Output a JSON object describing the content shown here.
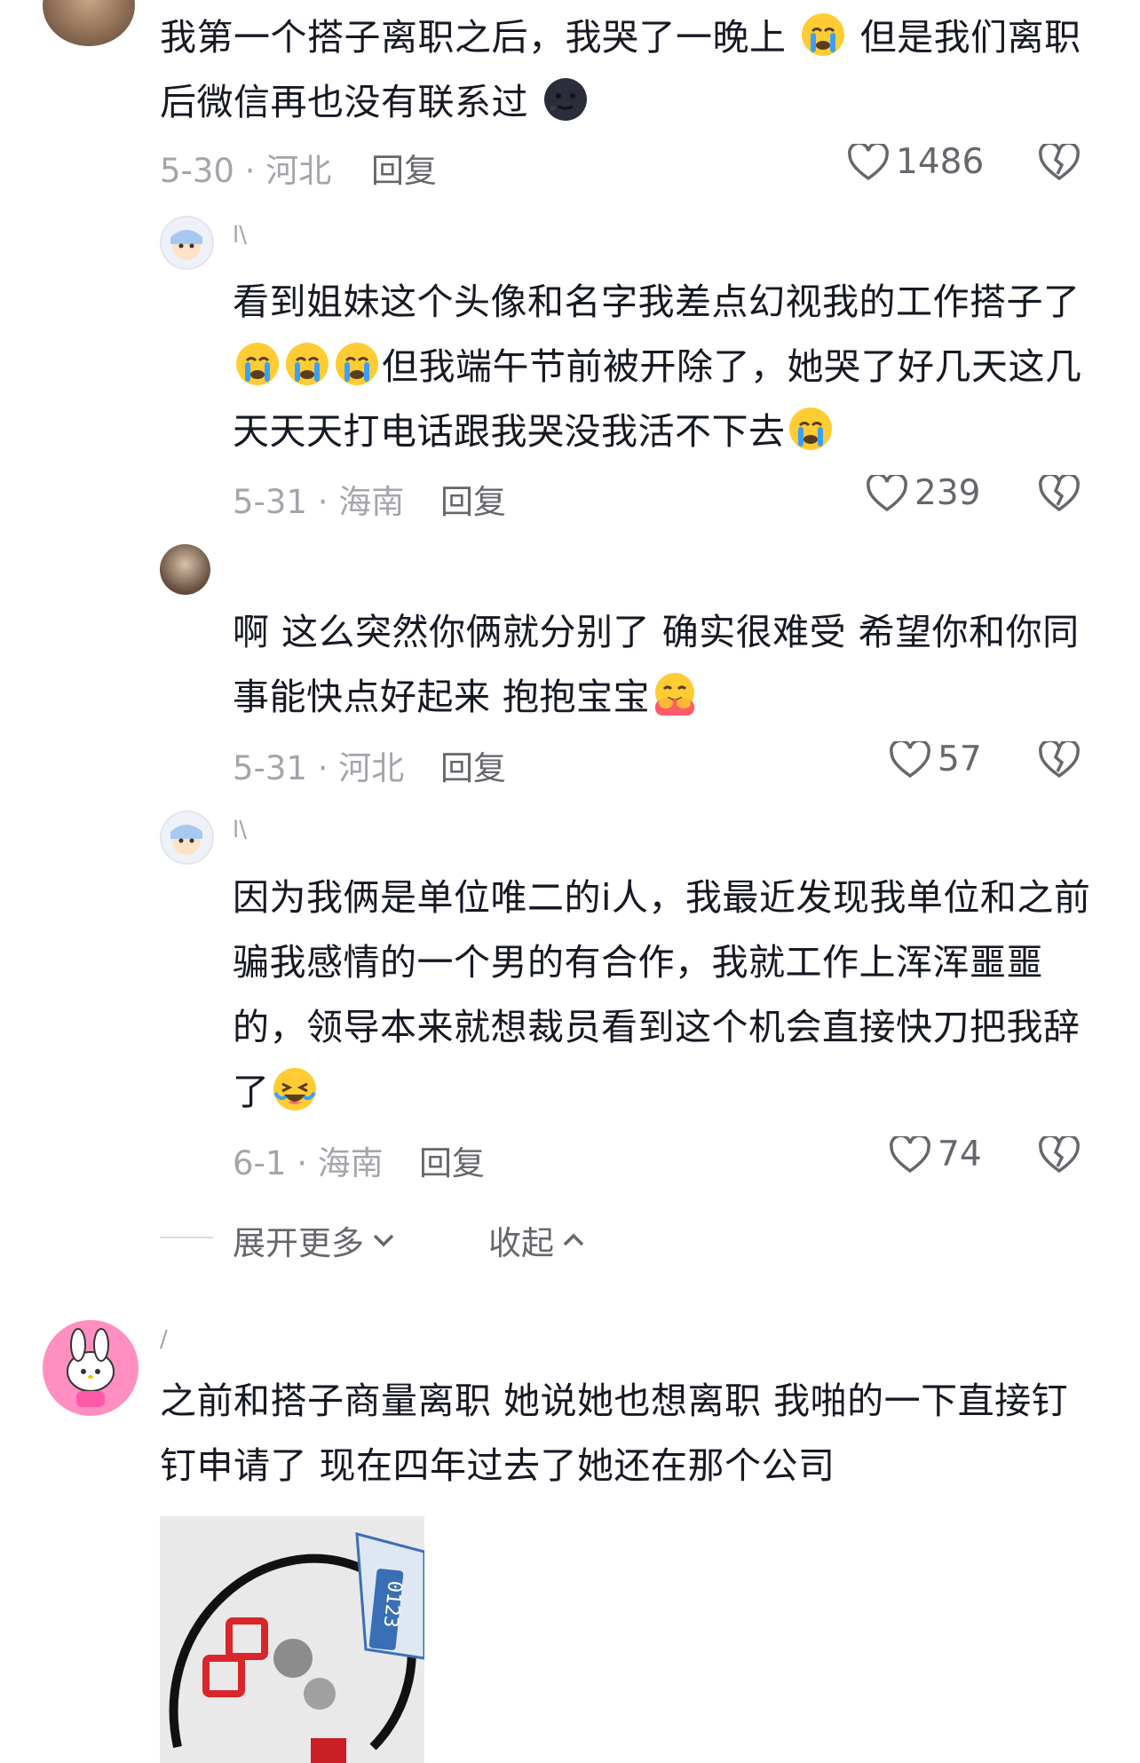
{
  "comments": [
    {
      "text_a": "我第一个搭子离职之后，我哭了一晚上",
      "text_b": "但是我们离职后微信再也没有联系过",
      "date_loc": "5-30 · 河北",
      "reply": "回复",
      "likes": "1486"
    }
  ],
  "replies": [
    {
      "username": "l\\",
      "text_a": "看到姐妹这个头像和名字我差点幻视我的工作搭子了",
      "text_b": "但我端午节前被开除了，她哭了好几天这几天天天打电话跟我哭没我活不下去",
      "date_loc": "5-31 · 海南",
      "reply": "回复",
      "likes": "239"
    },
    {
      "username": "",
      "text_a": "啊 这么突然你俩就分别了 确实很难受 希望你和你同事能快点好起来 抱抱宝宝",
      "date_loc": "5-31 · 河北",
      "reply": "回复",
      "likes": "57"
    },
    {
      "username": "l\\",
      "text_a": "因为我俩是单位唯二的i人，我最近发现我单位和之前骗我感情的一个男的有合作，我就工作上浑浑噩噩的，领导本来就想裁员看到这个机会直接快刀把我辞了",
      "date_loc": "6-1 · 海南",
      "reply": "回复",
      "likes": "74"
    }
  ],
  "thread_controls": {
    "expand_more": "展开更多",
    "collapse": "收起"
  },
  "comment2": {
    "username": "/",
    "text": "之前和搭子商量离职 她说她也想离职 我啪的一下直接钉钉申请了 现在四年过去了她还在那个公司",
    "sticker_label": "0123"
  },
  "icons": [
    "heart-icon",
    "dislike-icon",
    "crying-emoji",
    "moon-face-emoji",
    "hug-emoji",
    "laughing-crying-emoji",
    "chevron-down-icon",
    "chevron-up-icon"
  ],
  "colors": {
    "text": "#161823",
    "meta": "#a3a5ab",
    "action": "#66676d"
  }
}
